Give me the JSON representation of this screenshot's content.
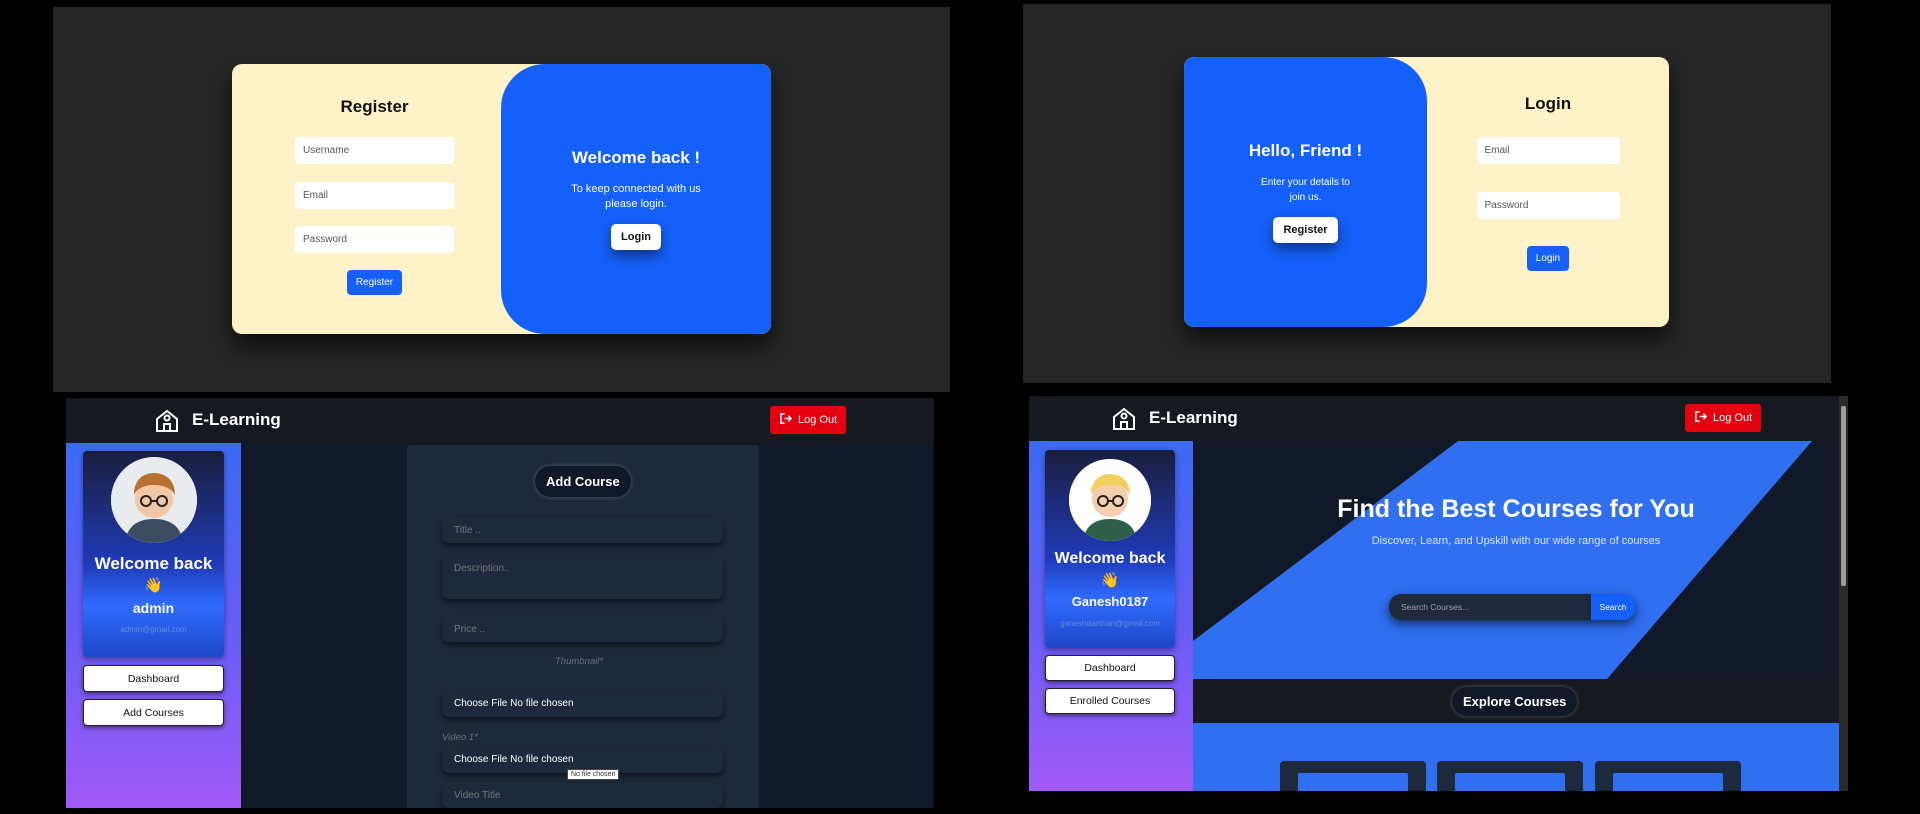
{
  "register_screen": {
    "title": "Register",
    "username_placeholder": "Username",
    "email_placeholder": "Email",
    "password_placeholder": "Password",
    "register_button": "Register",
    "welcome_title": "Welcome back !",
    "welcome_text": "To keep connected with us please login.",
    "login_button": "Login"
  },
  "login_screen": {
    "hello_title": "Hello, Friend !",
    "hello_text": "Enter your details to join us.",
    "register_button": "Register",
    "title": "Login",
    "email_placeholder": "Email",
    "password_placeholder": "Password",
    "login_button": "Login"
  },
  "admin_dashboard": {
    "brand": "E-Learning",
    "logout": "Log Out",
    "welcome": "Welcome back",
    "wave": "👋",
    "username": "admin",
    "email": "admin@gmail.com",
    "nav": [
      "Dashboard",
      "Add Courses"
    ],
    "form_title": "Add Course",
    "title_placeholder": "Title ..",
    "description_placeholder": "Description..",
    "price_placeholder": "Price ..",
    "thumbnail_label": "Thumbnail*",
    "file_choose_1": "Choose File No file chosen",
    "video_label": "Video 1*",
    "file_choose_2": "Choose File No file chosen",
    "tooltip": "No file chosen",
    "video_title_placeholder": "Video Title"
  },
  "user_dashboard": {
    "brand": "E-Learning",
    "logout": "Log Out",
    "welcome": "Welcome back",
    "wave": "👋",
    "username": "Ganesh0187",
    "email": "ganeshdarshan@gmail.com",
    "nav": [
      "Dashboard",
      "Enrolled Courses"
    ],
    "hero_title": "Find the Best Courses for You",
    "hero_subtitle": "Discover, Learn, and Upskill with our wide range of courses",
    "search_placeholder": "Search Courses...",
    "search_button": "Search",
    "explore": "Explore Courses"
  },
  "colors": {
    "primary_blue": "#1560fa",
    "cream": "#fdf2c8",
    "logout_red": "#e4000f",
    "dark_bg": "#111827"
  }
}
